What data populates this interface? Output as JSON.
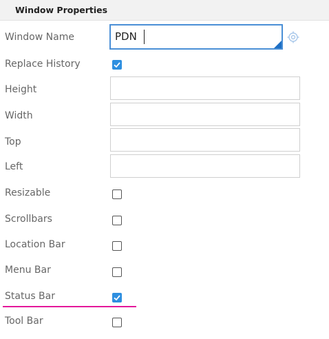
{
  "panel": {
    "title": "Window Properties"
  },
  "fields": {
    "window_name": {
      "label": "Window Name",
      "value": "PDN"
    },
    "replace_history": {
      "label": "Replace History",
      "checked": true
    },
    "height": {
      "label": "Height",
      "value": ""
    },
    "width": {
      "label": "Width",
      "value": ""
    },
    "top": {
      "label": "Top",
      "value": ""
    },
    "left": {
      "label": "Left",
      "value": ""
    },
    "resizable": {
      "label": "Resizable",
      "checked": false
    },
    "scrollbars": {
      "label": "Scrollbars",
      "checked": false
    },
    "location_bar": {
      "label": "Location Bar",
      "checked": false
    },
    "menu_bar": {
      "label": "Menu Bar",
      "checked": false
    },
    "status_bar": {
      "label": "Status Bar",
      "checked": true
    },
    "tool_bar": {
      "label": "Tool Bar",
      "checked": false
    }
  },
  "colors": {
    "accent": "#2e8fe0",
    "focus_border": "#4a8fd6",
    "highlight_underline": "#e3179a"
  },
  "icons": {
    "target": "target-icon"
  }
}
